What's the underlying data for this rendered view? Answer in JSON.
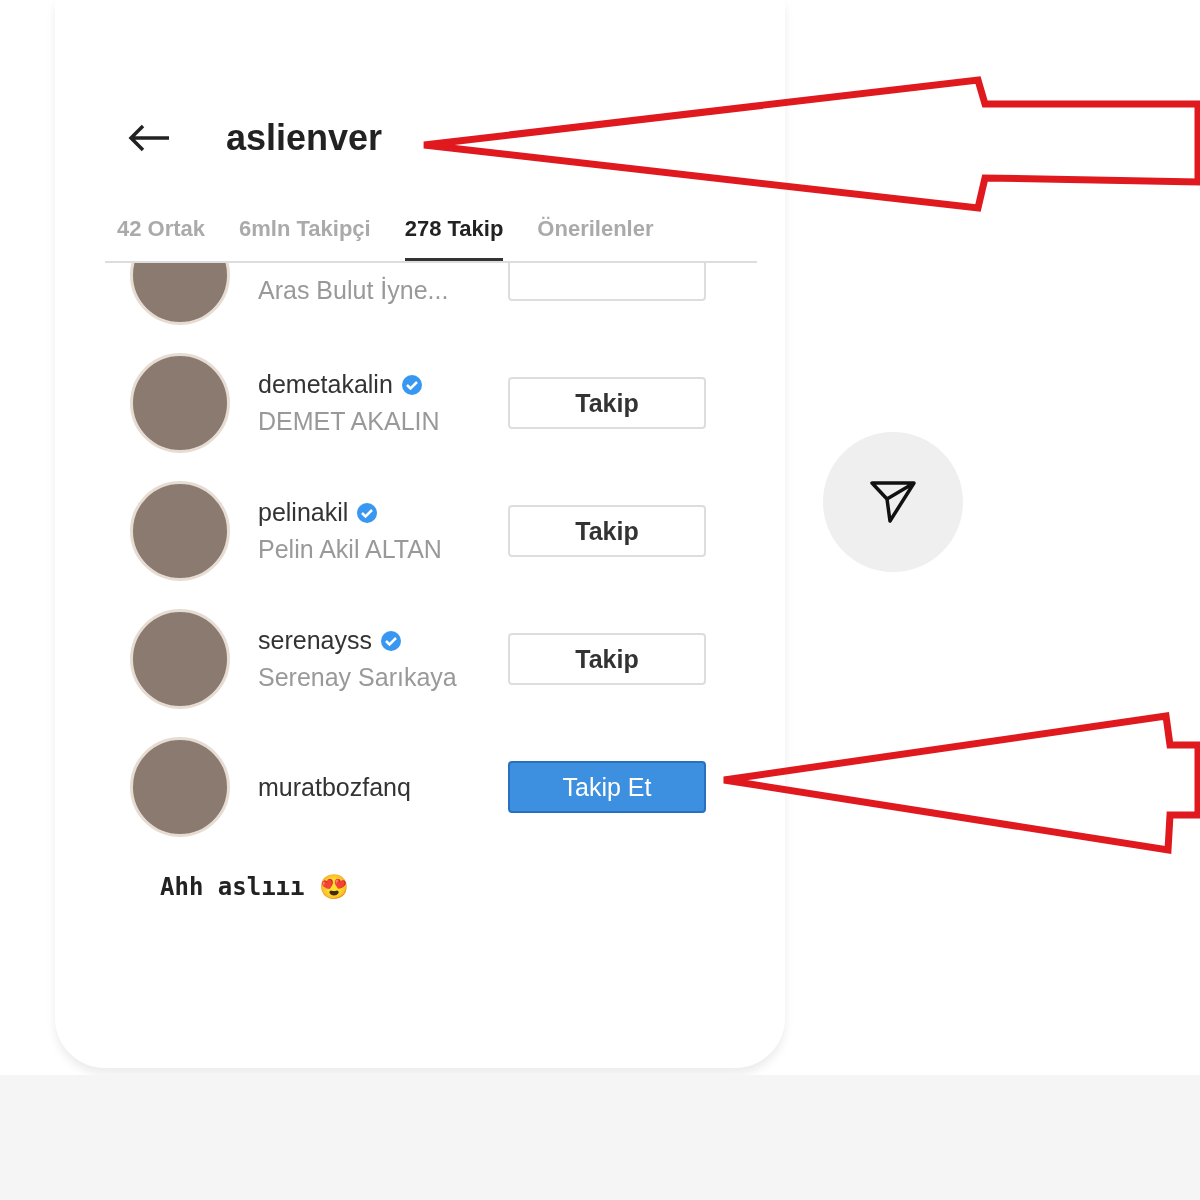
{
  "header": {
    "username": "aslienver"
  },
  "tabs": [
    {
      "label": "42 Ortak",
      "selected": false
    },
    {
      "label": "6mln Takipçi",
      "selected": false
    },
    {
      "label": "278 Takip",
      "selected": true
    },
    {
      "label": "Önerilenler",
      "selected": false
    }
  ],
  "users": [
    {
      "fullname": "Aras Bulut İyne...",
      "following": true
    },
    {
      "username": "demetakalin",
      "verified": true,
      "fullname": "DEMET AKALIN",
      "button": "Takip",
      "following": true
    },
    {
      "username": "pelinakil",
      "verified": true,
      "fullname": "Pelin Akil ALTAN",
      "button": "Takip",
      "following": true
    },
    {
      "username": "serenayss",
      "verified": true,
      "fullname": "Serenay Sarıkaya",
      "button": "Takip",
      "following": true
    },
    {
      "username": "muratbozfanq",
      "verified": false,
      "button": "Takip Et",
      "following": false
    }
  ],
  "caption": "Ahh aslııı 😍"
}
